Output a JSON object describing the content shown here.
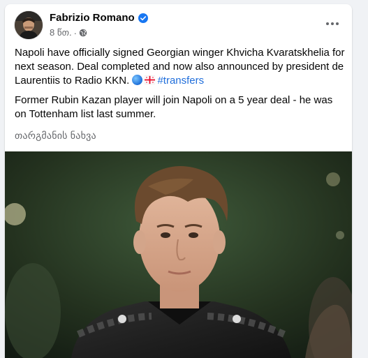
{
  "post": {
    "author": "Fabrizio Romano",
    "verified_icon": "verified-badge-icon",
    "time": "8 წთ.",
    "separator": "·",
    "audience_icon": "globe-icon",
    "more_icon": "more-options-icon",
    "paragraph1_text": "Napoli have officially signed Georgian winger Khvicha Kvaratskhelia for next season. Deal completed and now also announced by president de Laurentiis to Radio KKN.",
    "paragraph1_icons": [
      "blue-circle-emoji",
      "georgia-flag-emoji"
    ],
    "hashtag": "#transfers",
    "paragraph2": "Former Rubin Kazan player will join Napoli on a 5 year deal - he was on Tottenham list last summer.",
    "translate_link": "თარგმანის ნახვა",
    "photo_alt": "player-photo"
  },
  "colors": {
    "background": "#f0f2f5",
    "card": "#ffffff",
    "verified": "#1877f2",
    "hashtag": "#216fdb",
    "secondary_text": "#65676b"
  }
}
